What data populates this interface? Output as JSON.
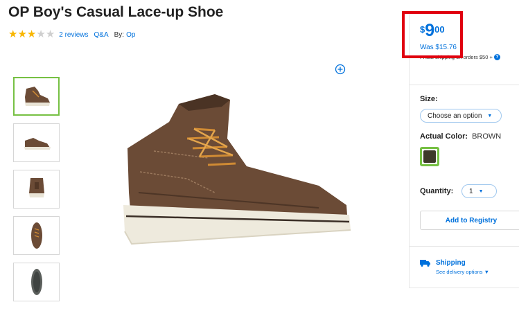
{
  "product": {
    "title": "OP Boy's Casual Lace-up Shoe",
    "rating_stars": 3,
    "rating_max": 5,
    "reviews_label": "2 reviews",
    "qa_label": "Q&A",
    "by_label": "By:",
    "brand_label": "Op"
  },
  "gallery": {
    "thumbnails": [
      {
        "view": "side-angle",
        "selected": true
      },
      {
        "view": "side",
        "selected": false
      },
      {
        "view": "back",
        "selected": false
      },
      {
        "view": "top",
        "selected": false
      },
      {
        "view": "sole",
        "selected": false
      }
    ],
    "zoom_icon": "plus-circle-icon"
  },
  "price": {
    "currency": "$",
    "dollars": "9",
    "cents": "00",
    "was": "Was $15.76",
    "shipping_note": "FREE shipping on orders $50 +",
    "info_icon": "?"
  },
  "options": {
    "size_label": "Size:",
    "size_placeholder": "Choose an option",
    "color_label": "Actual Color:",
    "color_value": "BROWN",
    "swatch_color": "#3d3829",
    "quantity_label": "Quantity:",
    "quantity_value": "1",
    "caret": "▼"
  },
  "actions": {
    "registry_label": "Add to Registry"
  },
  "shipping": {
    "title": "Shipping",
    "link": "See delivery options",
    "caret": "▼"
  },
  "colors": {
    "accent": "#0071dc",
    "highlight": "#e0000f",
    "selected": "#76c043",
    "star": "#f8b600"
  }
}
